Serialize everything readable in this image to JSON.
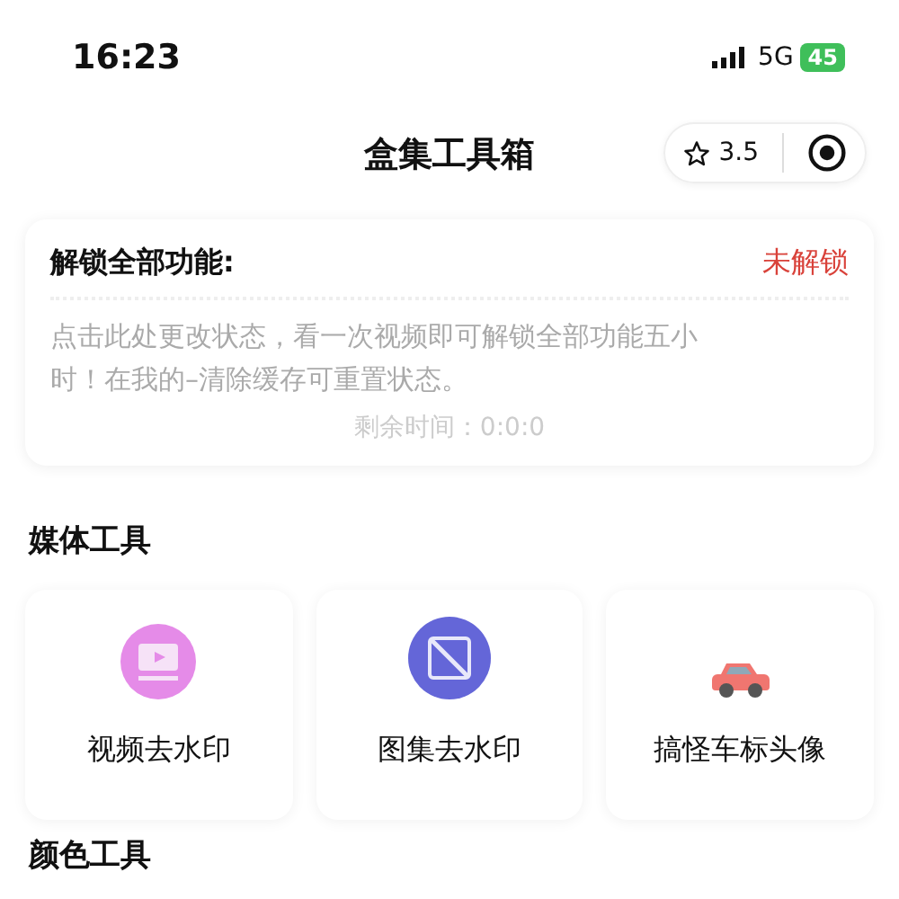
{
  "status_bar": {
    "time": "16:23",
    "network": "5G",
    "battery": "45"
  },
  "nav": {
    "title": "盒集工具箱",
    "rating": "3.5"
  },
  "unlock_card": {
    "title": "解锁全部功能:",
    "status": "未解锁",
    "unlocked": false,
    "description": "点击此处更改状态，看一次视频即可解锁全部功能五小时！在我的–清除缓存可重置状态。",
    "remaining": "剩余时间：0:0:0"
  },
  "sections": [
    {
      "title": "媒体工具",
      "tools": [
        {
          "label": "视频去水印",
          "kind": "video"
        },
        {
          "label": "图集去水印",
          "kind": "image"
        },
        {
          "label": "搞怪车标头像",
          "kind": "car"
        }
      ]
    },
    {
      "title": "颜色工具"
    }
  ]
}
